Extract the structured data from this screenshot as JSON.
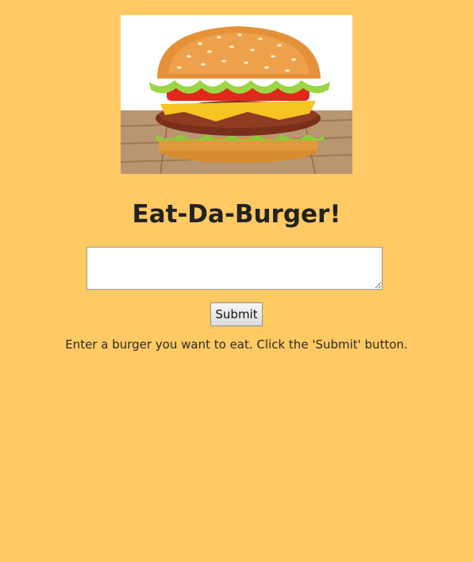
{
  "page": {
    "title": "Eat-Da-Burger!",
    "background_color": "#FFC964"
  },
  "hero": {
    "icon": "burger-photo"
  },
  "form": {
    "input_value": "",
    "input_placeholder": "",
    "submit_label": "Submit"
  },
  "hint": {
    "text": "Enter a burger you want to eat. Click the 'Submit' button."
  }
}
